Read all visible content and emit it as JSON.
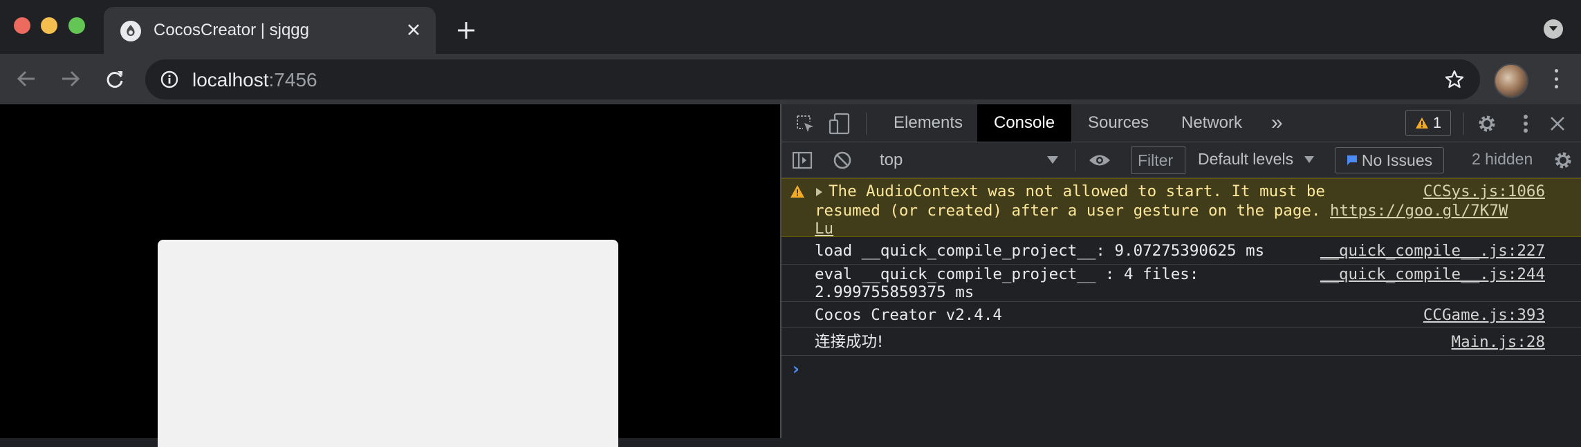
{
  "browser": {
    "tab": {
      "title": "CocosCreator | sjqgg",
      "favicon": "cocos-logo-icon"
    },
    "address": {
      "host": "localhost",
      "port": ":7456"
    },
    "colors": {
      "close": "#ed6a5e",
      "minimize": "#f5bf4f",
      "maximize": "#62c554"
    }
  },
  "devtools": {
    "tabs": [
      "Elements",
      "Console",
      "Sources",
      "Network"
    ],
    "active_tab": "Console",
    "more_tabs": "»",
    "warning_count": "1",
    "context": "top",
    "filter_placeholder": "Filter",
    "levels": "Default levels",
    "issues": "No Issues",
    "hidden": "2 hidden"
  },
  "console": {
    "warning": {
      "line1": "The AudioContext was not allowed to start. It must be",
      "line2": "resumed (or created) after a user gesture on the page. ",
      "link_a": "https://goo.gl/7K7W",
      "link_b": "Lu",
      "source": "CCSys.js:1066"
    },
    "messages": [
      {
        "text": "load __quick_compile_project__: 9.07275390625 ms",
        "source": "__quick_compile__.js:227"
      },
      {
        "text": "eval __quick_compile_project__ : 4 files:",
        "text2": "2.999755859375 ms",
        "source": "__quick_compile__.js:244"
      },
      {
        "text": "Cocos Creator v2.4.4",
        "source": "CCGame.js:393"
      },
      {
        "text": "连接成功!",
        "source": "Main.js:28"
      }
    ],
    "prompt": "›"
  }
}
